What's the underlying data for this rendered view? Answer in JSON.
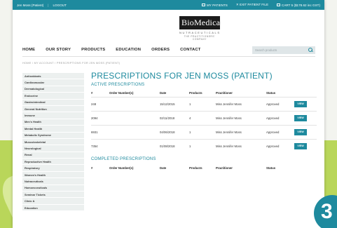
{
  "topbar": {
    "user": "Jen Moss (Patient)",
    "logout": "LOGOUT",
    "my_patients": "MY PATIENTS",
    "exit_patient_file": "EXIT PATIENT FILE",
    "cart": "CART 5 ($178.62 inc GST)"
  },
  "logo": {
    "name": "BioMedica",
    "line1": "NUTRACEUTICALS",
    "line2": "THE PRACTITIONERS' COMPANY"
  },
  "nav": {
    "items": [
      "HOME",
      "OUR STORY",
      "PRODUCTS",
      "EDUCATION",
      "ORDERS",
      "CONTACT"
    ],
    "search_placeholder": "Search products"
  },
  "breadcrumb": "HOME  /  MY ACCOUNT  /  PRESCRIPTIONS FOR JEN MOSS (PATIENT)",
  "sidebar": {
    "items": [
      "Antioxidants",
      "Cardiovascular",
      "Dermatological",
      "Endocrine",
      "Gastrointestinal",
      "General Nutrition",
      "Immune",
      "Men's Health",
      "Mental Health",
      "Metabolic Syndrome",
      "Musculoskeletal",
      "Neurological",
      "Renal",
      "Reproductive Health",
      "Respiratory",
      "Women's Health",
      "Nutraceuticals",
      "Homoeoceuticals",
      "Seminar Tickets",
      "Clinic &",
      "Education"
    ]
  },
  "main": {
    "title": "PRESCRIPTIONS FOR JEN MOSS (PATIENT)",
    "active_heading": "ACTIVE PRESCRIPTIONS",
    "completed_heading": "COMPLETED PRESCRIPTIONS",
    "columns": [
      "#",
      "Order Number(s)",
      "Date",
      "Products",
      "Practitioner",
      "Status"
    ],
    "active_rows": [
      {
        "num": "248",
        "order": "",
        "date": "15/12/2015",
        "products": "1",
        "practitioner": "Miss Jennifer Moss",
        "status": "Approved",
        "action": "VIEW"
      },
      {
        "num": "2094",
        "order": "",
        "date": "02/11/2018",
        "products": "4",
        "practitioner": "Miss Jennifer Moss",
        "status": "Approved",
        "action": "VIEW"
      },
      {
        "num": "6931",
        "order": "",
        "date": "04/06/2018",
        "products": "1",
        "practitioner": "Miss Jennifer Moss",
        "status": "Approved",
        "action": "VIEW"
      },
      {
        "num": "7354",
        "order": "",
        "date": "01/08/2018",
        "products": "1",
        "practitioner": "Miss Jennifer Moss",
        "status": "Approved",
        "action": "VIEW"
      }
    ]
  },
  "badge": "3",
  "colors": {
    "accent": "#1e8a9e",
    "green": "#b9d65a"
  }
}
